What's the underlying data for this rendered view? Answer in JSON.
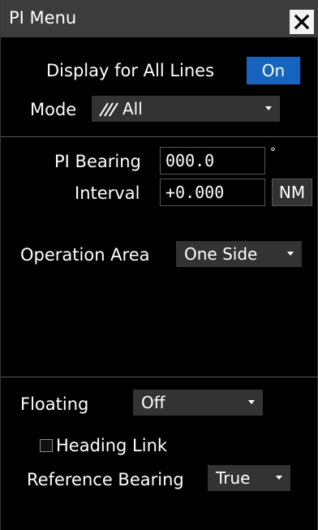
{
  "window": {
    "title": "PI Menu"
  },
  "display_all_lines": {
    "label": "Display for All Lines",
    "button": "On"
  },
  "mode": {
    "label": "Mode",
    "value": "All"
  },
  "pi_bearing": {
    "label": "PI Bearing",
    "value": "000.0",
    "unit": "°"
  },
  "interval": {
    "label": "Interval",
    "value": "+0.000",
    "unit": "NM"
  },
  "operation_area": {
    "label": "Operation Area",
    "value": "One Side"
  },
  "floating": {
    "label": "Floating",
    "value": "Off"
  },
  "heading_link": {
    "label": "Heading Link",
    "checked": false
  },
  "reference_bearing": {
    "label": "Reference Bearing",
    "value": "True"
  },
  "colors": {
    "accent": "#1565c0",
    "dropdown_bg": "#333333",
    "title_bg": "#3c3c3c"
  }
}
